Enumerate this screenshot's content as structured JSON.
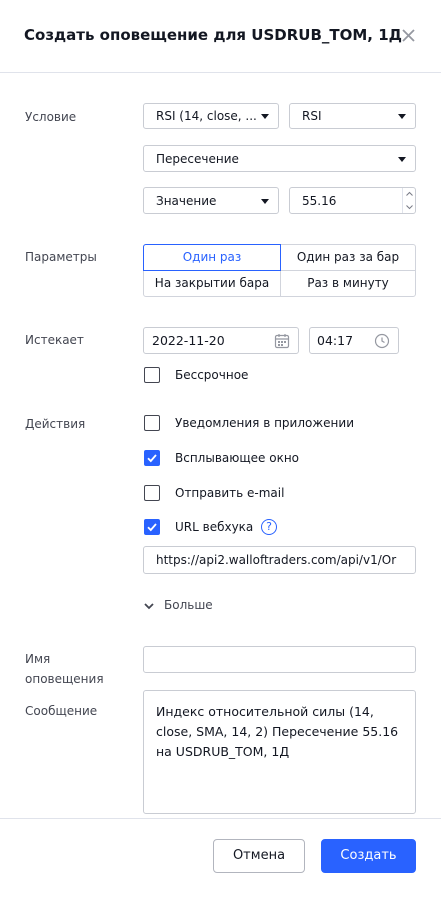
{
  "dialog": {
    "title": "Создать оповещение для USDRUB_TOM, 1Д"
  },
  "condition": {
    "label": "Условие",
    "indicator": "RSI (14, close, ...",
    "line": "RSI",
    "operator": "Пересечение",
    "value_type": "Значение",
    "value": "55.16"
  },
  "params": {
    "label": "Параметры",
    "options": [
      "Один раз",
      "Один раз за бар",
      "На закрытии бара",
      "Раз в минуту"
    ],
    "selected": "Один раз"
  },
  "expires": {
    "label": "Истекает",
    "date": "2022-11-20",
    "time": "04:17",
    "open_ended_label": "Бессрочное",
    "open_ended_checked": false
  },
  "actions": {
    "label": "Действия",
    "app_notify": {
      "label": "Уведомления в приложении",
      "checked": false
    },
    "popup": {
      "label": "Всплывающее окно",
      "checked": true
    },
    "email": {
      "label": "Отправить e-mail",
      "checked": false
    },
    "webhook": {
      "label": "URL вебхука",
      "checked": true,
      "url": "https://api2.walloftraders.com/api/v1/Or"
    },
    "more_label": "Больше"
  },
  "alert_name": {
    "label_line1": "Имя",
    "label_line2": "оповещения",
    "value": ""
  },
  "message": {
    "label": "Сообщение",
    "text": "Индекс относительной силы (14, close, SMA, 14, 2) Пересечение 55.16 на USDRUB_TOM, 1Д"
  },
  "footer": {
    "cancel": "Отмена",
    "create": "Создать"
  },
  "colors": {
    "accent": "#2962ff",
    "text": "#131722",
    "border": "#c9ccd3"
  }
}
